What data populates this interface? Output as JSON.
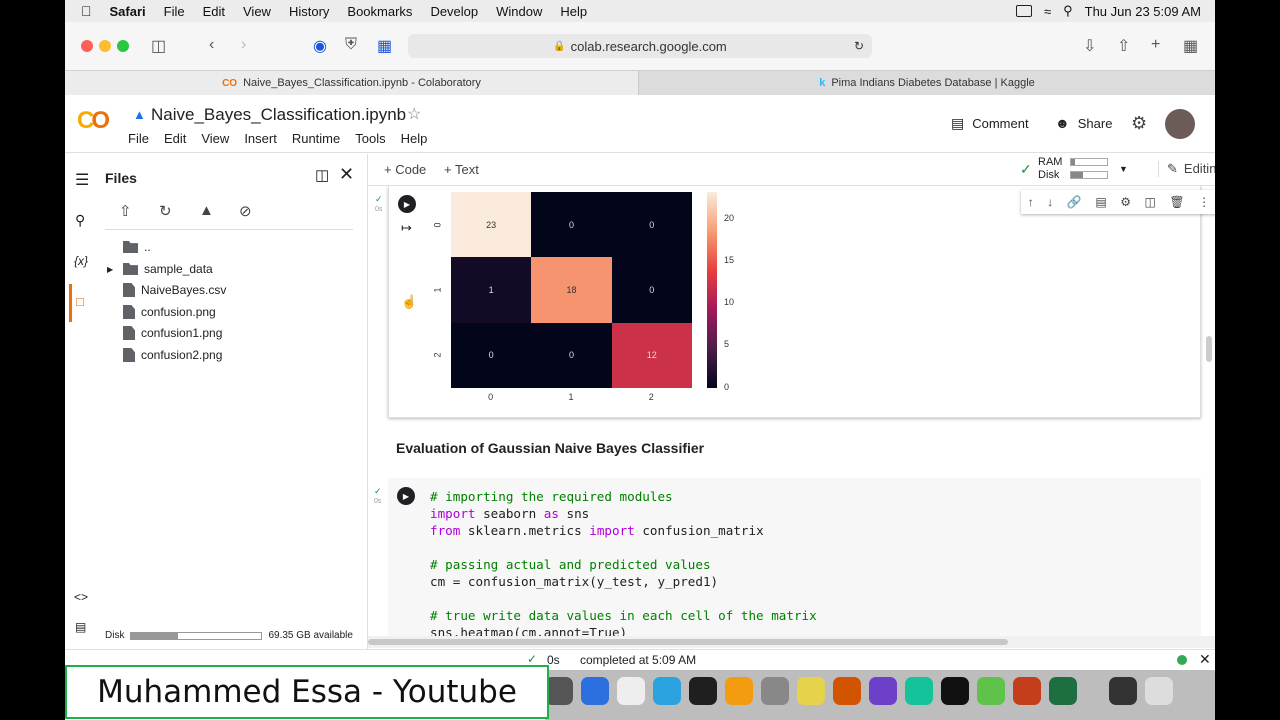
{
  "menubar": {
    "app": "Safari",
    "items": [
      "File",
      "Edit",
      "View",
      "History",
      "Bookmarks",
      "Develop",
      "Window",
      "Help"
    ],
    "datetime": "Thu Jun 23  5:09 AM"
  },
  "browser": {
    "url": "colab.research.google.com"
  },
  "tabs": [
    {
      "label": "Naive_Bayes_Classification.ipynb - Colaboratory",
      "icon": "colab-icon"
    },
    {
      "label": "Pima Indians Diabetes Database | Kaggle",
      "icon": "kaggle-icon"
    }
  ],
  "colab": {
    "title": "Naive_Bayes_Classification.ipynb",
    "menu": [
      "File",
      "Edit",
      "View",
      "Insert",
      "Runtime",
      "Tools",
      "Help"
    ],
    "comment": "Comment",
    "share": "Share"
  },
  "files": {
    "title": "Files",
    "items": [
      {
        "name": "..",
        "type": "up"
      },
      {
        "name": "sample_data",
        "type": "folder"
      },
      {
        "name": "NaiveBayes.csv",
        "type": "file"
      },
      {
        "name": "confusion.png",
        "type": "file"
      },
      {
        "name": "confusion1.png",
        "type": "file"
      },
      {
        "name": "confusion2.png",
        "type": "file"
      }
    ],
    "disk_label": "Disk",
    "disk_available": "69.35 GB available",
    "disk_used_fraction": 0.36
  },
  "toolbar": {
    "code": "+ Code",
    "text": "+ Text",
    "ram": "RAM",
    "disk": "Disk",
    "editing": "Editing"
  },
  "heatmap": {
    "cells": [
      [
        23,
        0,
        0
      ],
      [
        1,
        18,
        0
      ],
      [
        0,
        0,
        12
      ]
    ],
    "xticks": [
      "0",
      "1",
      "2"
    ],
    "yticks": [
      "0",
      "1",
      "2"
    ],
    "colorbar_ticks": [
      "20",
      "15",
      "10",
      "5",
      "0"
    ]
  },
  "text_cell": {
    "heading": "Evaluation of Gaussian Naive Bayes Classifier"
  },
  "code_cell": {
    "lines": [
      "# importing the required modules",
      "import seaborn as sns",
      "from sklearn.metrics import confusion_matrix",
      "",
      "# passing actual and predicted values",
      "cm = confusion_matrix(y_test, y_pred1)",
      "",
      "# true write data values in each cell of the matrix",
      "sns.heatmap(cm,annot=True)"
    ],
    "exec_time": "0s"
  },
  "status": {
    "time": "0s",
    "message": "completed at 5:09 AM"
  },
  "watermark": "Muhammed Essa - Youtube"
}
